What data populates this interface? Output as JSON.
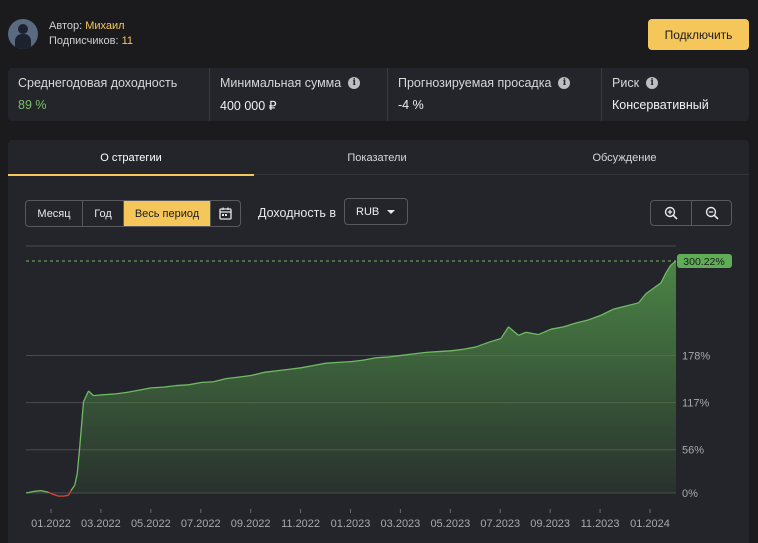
{
  "author": {
    "label": "Автор:",
    "name": "Михаил",
    "subs_label": "Подписчиков:",
    "subs_count": "11"
  },
  "connect_button": "Подключить",
  "stats": [
    {
      "label": "Среднегодовая доходность",
      "value": "89 %",
      "info": false,
      "value_color": "#7cbf6a"
    },
    {
      "label": "Минимальная сумма",
      "value": "400 000 ₽",
      "info": true
    },
    {
      "label": "Прогнозируемая просадка",
      "value": "-4 %",
      "info": true
    },
    {
      "label": "Риск",
      "value": "Консервативный",
      "info": true
    }
  ],
  "tabs": [
    {
      "label": "О стратегии",
      "active": true
    },
    {
      "label": "Показатели",
      "active": false
    },
    {
      "label": "Обсуждение",
      "active": false
    }
  ],
  "period": {
    "options": [
      "Месяц",
      "Год",
      "Весь период"
    ],
    "selected": "Весь период",
    "calendar_icon": "calendar-icon"
  },
  "yield_label": "Доходность в",
  "currency": {
    "selected": "RUB",
    "icon": "chevron-down-icon"
  },
  "zoom": {
    "in_icon": "zoom-in-icon",
    "out_icon": "zoom-out-icon"
  },
  "colors": {
    "accent": "#f5c75a",
    "line": "#6fbb63",
    "fill_top": "#4d8a47",
    "negative": "#e0453c",
    "positive_text": "#7cbf6a"
  },
  "chart_data": {
    "type": "area",
    "x_ticks": [
      "01.2022",
      "03.2022",
      "05.2022",
      "07.2022",
      "09.2022",
      "11.2022",
      "01.2023",
      "03.2023",
      "05.2023",
      "07.2023",
      "09.2023",
      "11.2023",
      "01.2024"
    ],
    "y_ticks": [
      "0%",
      "56%",
      "117%",
      "178%"
    ],
    "y_tick_values": [
      0,
      56,
      117,
      178
    ],
    "last_value_label": "300.22%",
    "last_value": 300.22,
    "ylim": [
      0,
      300.22
    ],
    "grid": true,
    "x_unit": "months since 01.2022",
    "series": [
      {
        "points": [
          [
            0,
            0
          ],
          [
            0.3,
            2
          ],
          [
            0.6,
            3
          ],
          [
            0.9,
            1
          ],
          [
            1.1,
            -2
          ],
          [
            1.3,
            -4
          ],
          [
            1.5,
            -4
          ],
          [
            1.7,
            -3
          ],
          [
            1.8,
            3
          ],
          [
            1.95,
            10
          ],
          [
            2.05,
            25
          ],
          [
            2.15,
            60
          ],
          [
            2.3,
            118
          ],
          [
            2.5,
            132
          ],
          [
            2.7,
            126
          ],
          [
            3.0,
            127
          ],
          [
            3.5,
            128
          ],
          [
            4.0,
            130
          ],
          [
            4.5,
            133
          ],
          [
            5.0,
            136
          ],
          [
            5.5,
            137
          ],
          [
            6.0,
            139
          ],
          [
            6.5,
            140
          ],
          [
            7.0,
            143
          ],
          [
            7.5,
            144
          ],
          [
            8.0,
            148
          ],
          [
            8.5,
            150
          ],
          [
            9.0,
            152
          ],
          [
            9.5,
            156
          ],
          [
            10.0,
            158
          ],
          [
            10.5,
            160
          ],
          [
            11.0,
            162
          ],
          [
            11.5,
            165
          ],
          [
            12.0,
            168
          ],
          [
            12.5,
            169
          ],
          [
            13.0,
            170
          ],
          [
            13.5,
            172
          ],
          [
            14.0,
            175
          ],
          [
            14.5,
            176
          ],
          [
            15.0,
            178
          ],
          [
            15.5,
            180
          ],
          [
            16.0,
            182
          ],
          [
            16.5,
            183
          ],
          [
            17.0,
            184
          ],
          [
            17.5,
            186
          ],
          [
            18.0,
            189
          ],
          [
            18.5,
            195
          ],
          [
            19.0,
            200
          ],
          [
            19.3,
            215
          ],
          [
            19.7,
            204
          ],
          [
            20.0,
            208
          ],
          [
            20.5,
            205
          ],
          [
            21.0,
            212
          ],
          [
            21.5,
            215
          ],
          [
            22.0,
            220
          ],
          [
            22.5,
            224
          ],
          [
            23.0,
            230
          ],
          [
            23.5,
            238
          ],
          [
            24.0,
            242
          ],
          [
            24.5,
            246
          ],
          [
            24.8,
            258
          ],
          [
            25.1,
            265
          ],
          [
            25.4,
            272
          ],
          [
            25.6,
            285
          ],
          [
            25.8,
            295
          ],
          [
            26.0,
            300.22
          ]
        ]
      }
    ]
  }
}
